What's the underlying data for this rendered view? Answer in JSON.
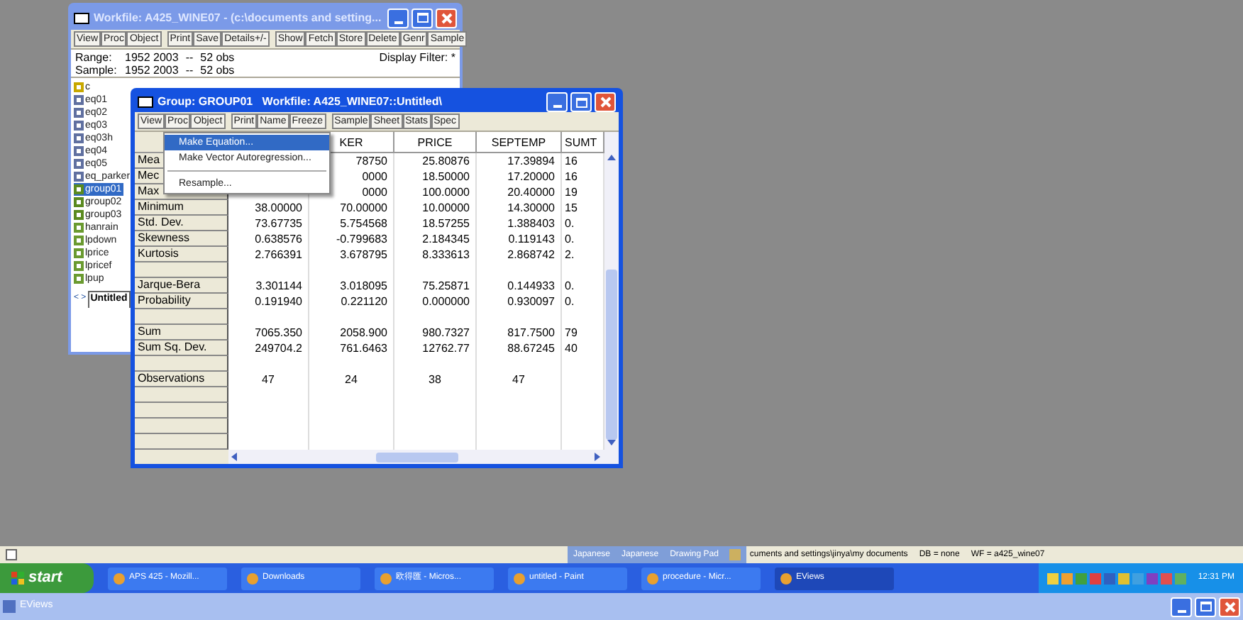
{
  "workfile": {
    "title": "Workfile: A425_WINE07 - (c:\\documents and setting...",
    "toolbar": [
      [
        "View",
        "Proc",
        "Object"
      ],
      [
        "Print",
        "Save",
        "Details+/-"
      ],
      [
        "Show",
        "Fetch",
        "Store",
        "Delete",
        "Genr",
        "Sample"
      ]
    ],
    "info": [
      {
        "label": "Range:",
        "value": "1952 2003",
        "dash": "--",
        "obs": "52 obs"
      },
      {
        "label": "Sample:",
        "value": "1952 2003",
        "dash": "--",
        "obs": "52 obs"
      }
    ],
    "display_filter": "Display Filter: *",
    "objects": [
      {
        "kind": "coef",
        "name": "c",
        "selected": false
      },
      {
        "kind": "equation",
        "name": "eq01",
        "selected": false
      },
      {
        "kind": "equation",
        "name": "eq02",
        "selected": false
      },
      {
        "kind": "equation",
        "name": "eq03",
        "selected": false
      },
      {
        "kind": "equation",
        "name": "eq03h",
        "selected": false
      },
      {
        "kind": "equation",
        "name": "eq04",
        "selected": false
      },
      {
        "kind": "equation",
        "name": "eq05",
        "selected": false
      },
      {
        "kind": "equation",
        "name": "eq_parker",
        "selected": false
      },
      {
        "kind": "group",
        "name": "group01",
        "selected": true
      },
      {
        "kind": "group",
        "name": "group02",
        "selected": false
      },
      {
        "kind": "group",
        "name": "group03",
        "selected": false
      },
      {
        "kind": "series",
        "name": "hanrain",
        "selected": false
      },
      {
        "kind": "series",
        "name": "lpdown",
        "selected": false
      },
      {
        "kind": "series",
        "name": "lprice",
        "selected": false
      },
      {
        "kind": "series",
        "name": "lpricef",
        "selected": false
      },
      {
        "kind": "series",
        "name": "lpup",
        "selected": false
      }
    ],
    "tab_arrows": "< >",
    "tab": "Untitled"
  },
  "group": {
    "title": "Group: GROUP01   Workfile: A425_WINE07::Untitled\\",
    "toolbar": [
      [
        "View",
        "Proc",
        "Object"
      ],
      [
        "Print",
        "Name",
        "Freeze"
      ],
      [
        "Sample",
        "Sheet",
        "Stats",
        "Spec"
      ]
    ],
    "columns": [
      {},
      {
        "label": "KER"
      },
      {
        "label": "PRICE"
      },
      {
        "label": "SEPTEMP"
      },
      {
        "label": "SUMT"
      }
    ],
    "rows": [
      {
        "label": "Mea",
        "cells": [
          null,
          "78750",
          "25.80876",
          "17.39894",
          "16"
        ]
      },
      {
        "label": "Mec",
        "cells": [
          null,
          "0000",
          "18.50000",
          "17.20000",
          "16"
        ]
      },
      {
        "label": "Max",
        "cells": [
          null,
          "0000",
          "100.0000",
          "20.40000",
          "19"
        ]
      },
      {
        "label": "Minimum",
        "cells": [
          "38.00000",
          "70.00000",
          "10.00000",
          "14.30000",
          "15"
        ]
      },
      {
        "label": "Std. Dev.",
        "cells": [
          "73.67735",
          "5.754568",
          "18.57255",
          "1.388403",
          "0."
        ]
      },
      {
        "label": "Skewness",
        "cells": [
          "0.638576",
          "-0.799683",
          "2.184345",
          "0.119143",
          "0."
        ]
      },
      {
        "label": "Kurtosis",
        "cells": [
          "2.766391",
          "3.678795",
          "8.333613",
          "2.868742",
          "2."
        ]
      },
      {
        "kind": "blank"
      },
      {
        "label": "Jarque-Bera",
        "cells": [
          "3.301144",
          "3.018095",
          "75.25871",
          "0.144933",
          "0."
        ]
      },
      {
        "label": "Probability",
        "cells": [
          "0.191940",
          "0.221120",
          "0.000000",
          "0.930097",
          "0."
        ]
      },
      {
        "kind": "blank"
      },
      {
        "label": "Sum",
        "cells": [
          "7065.350",
          "2058.900",
          "980.7327",
          "817.7500",
          "79"
        ]
      },
      {
        "label": "Sum Sq. Dev.",
        "cells": [
          "249704.2",
          "761.6463",
          "12762.77",
          "88.67245",
          "40"
        ]
      },
      {
        "kind": "blank"
      },
      {
        "label": "Observations",
        "cells": [
          "47",
          "24",
          "38",
          "47",
          null
        ]
      }
    ],
    "menu": [
      {
        "label": "Make Equation...",
        "selected": true,
        "separator_before": false
      },
      {
        "label": "Make Vector Autoregression...",
        "selected": false,
        "separator_before": false
      },
      {
        "label": "Resample...",
        "selected": false,
        "separator_before": true
      }
    ]
  },
  "status_bar": {
    "checkbox": {
      "checked": false
    },
    "language_bar": [
      "Japanese",
      "Japanese",
      "Drawing Pad"
    ],
    "path": "cuments and settings\\jinya\\my documents",
    "db": "DB = none",
    "wf": "WF = a425_wine07"
  },
  "taskbar": {
    "start": "start",
    "tasks": [
      {
        "label": "APS 425 - Mozill...",
        "selected": false
      },
      {
        "label": "Downloads",
        "selected": false
      },
      {
        "label": "欧得匯 - Micros...",
        "selected": false
      },
      {
        "label": "untitled - Paint",
        "selected": false
      },
      {
        "label": "procedure - Micr...",
        "selected": false
      },
      {
        "label": "EViews",
        "selected": true
      }
    ],
    "clock": "12:31 PM"
  },
  "app_title": "EViews"
}
